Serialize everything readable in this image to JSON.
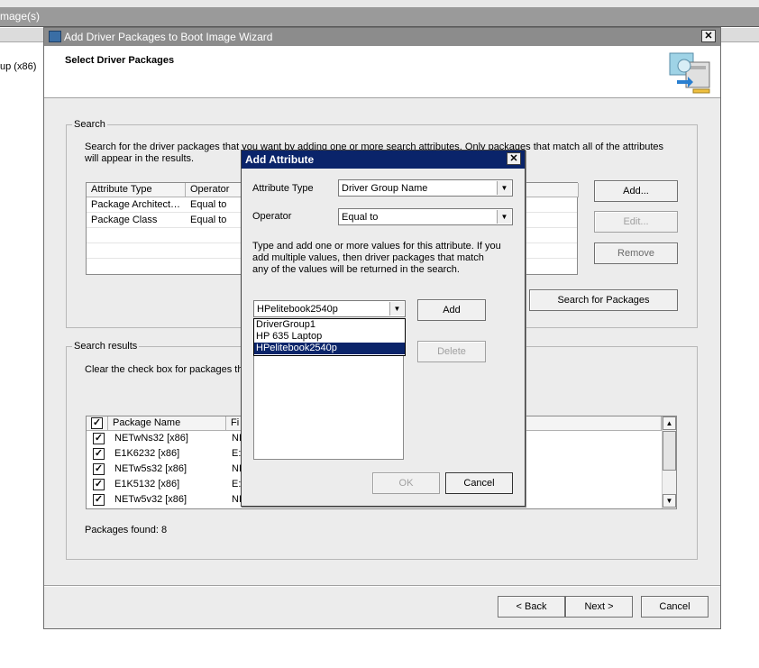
{
  "background_app": {
    "title_fragment": "mage(s)",
    "left_item": "up (x86)"
  },
  "wizard": {
    "title": "Add Driver Packages to Boot Image Wizard",
    "heading": "Select Driver Packages",
    "search_group_label": "Search",
    "search_description": "Search for the driver packages that you want by adding one or more search attributes. Only packages that match all of the attributes will appear in the results.",
    "attr_columns": [
      "Attribute Type",
      "Operator"
    ],
    "attr_rows": [
      {
        "type": "Package Architect…",
        "operator": "Equal to"
      },
      {
        "type": "Package Class",
        "operator": "Equal to"
      }
    ],
    "add_button": "Add...",
    "edit_button": "Edit...",
    "remove_button": "Remove",
    "search_button": "Search for Packages",
    "results_group_label": "Search results",
    "results_description": "Clear the check box for packages th",
    "results_columns": [
      "Package Name",
      "Fi"
    ],
    "results_rows": [
      {
        "name": "NETwNs32 [x86]",
        "file": "NI",
        "checked": true
      },
      {
        "name": "E1K6232 [x86]",
        "file": "E:",
        "checked": true
      },
      {
        "name": "NETw5s32 [x86]",
        "file": "NI",
        "checked": true
      },
      {
        "name": "E1K5132 [x86]",
        "file": "E:",
        "checked": true
      },
      {
        "name": "NETw5v32 [x86]",
        "file": "NI",
        "checked": true
      }
    ],
    "packages_found": "Packages found: 8",
    "back_button": "< Back",
    "next_button": "Next >",
    "cancel_button": "Cancel"
  },
  "dialog": {
    "title": "Add Attribute",
    "attribute_type_label": "Attribute Type",
    "attribute_type_value": "Driver Group Name",
    "operator_label": "Operator",
    "operator_value": "Equal to",
    "instructions": "Type and add one or more values for this attribute. If you add multiple values, then driver packages that match any of the values will be returned in the search.",
    "value_combo": "HPelitebook2540p",
    "dropdown_options": [
      "DriverGroup1",
      "HP 635 Laptop",
      "HPelitebook2540p"
    ],
    "selected_option_index": 2,
    "add_button": "Add",
    "delete_button": "Delete",
    "ok_button": "OK",
    "cancel_button": "Cancel"
  },
  "colors": {
    "title_bar": "#8c8c8c",
    "dialog_title_bar": "#0a246a",
    "selection": "#0a246a",
    "window_bg": "#ececec"
  }
}
